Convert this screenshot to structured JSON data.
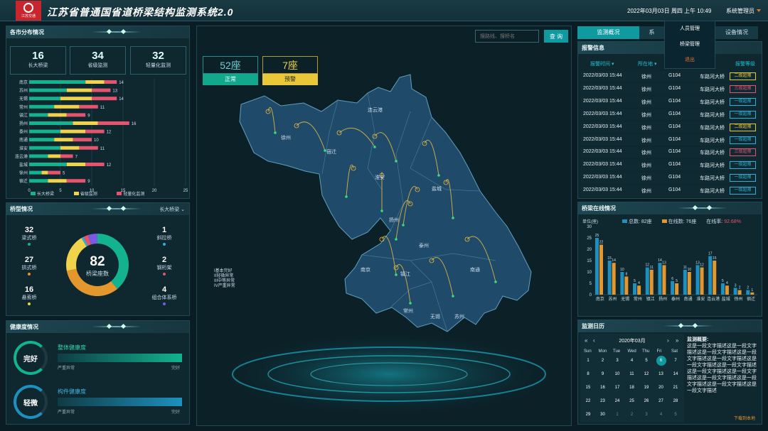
{
  "header": {
    "logo_text": "江苏交通",
    "title": "江苏省普通国省道桥梁结构监测系统2.0",
    "datetime": "2022年03月03日 周四 上午 10:49",
    "user": "系统管理员"
  },
  "dropdown": [
    "人员管理",
    "桥梁管理",
    "退出"
  ],
  "dist": {
    "title": "各市分布情况",
    "stats": [
      {
        "n": "16",
        "l": "长大桥梁"
      },
      {
        "n": "34",
        "l": "省级监测"
      },
      {
        "n": "32",
        "l": "轻量化监测"
      }
    ],
    "legend": [
      "长大桥梁",
      "省级监测",
      "轻量化监测"
    ],
    "colors": [
      "#12b38e",
      "#f0d34b",
      "#e4546e"
    ]
  },
  "chart_data": [
    {
      "type": "bar",
      "orientation": "horizontal",
      "stacked": true,
      "categories": [
        "南京",
        "苏州",
        "无锡",
        "常州",
        "镇江",
        "扬州",
        "泰州",
        "南通",
        "淮安",
        "连云港",
        "盐城",
        "徐州",
        "宿迁"
      ],
      "totals": [
        14,
        13,
        14,
        11,
        9,
        16,
        12,
        10,
        11,
        7,
        12,
        5,
        9
      ],
      "series": [
        {
          "name": "长大桥梁",
          "values": [
            9,
            6,
            5,
            4,
            3,
            7,
            5,
            4,
            5,
            3,
            6,
            2,
            3
          ]
        },
        {
          "name": "省级监测",
          "values": [
            3,
            4,
            5,
            4,
            3,
            4,
            4,
            3,
            3,
            2,
            3,
            1,
            3
          ]
        },
        {
          "name": "轻量化监测",
          "values": [
            2,
            3,
            4,
            3,
            3,
            5,
            3,
            3,
            3,
            2,
            3,
            2,
            3
          ]
        }
      ],
      "xlim": [
        0,
        25
      ],
      "xticks": [
        "0",
        "5",
        "10",
        "15",
        "20",
        "25"
      ]
    },
    {
      "type": "pie",
      "title": "桥梁座数",
      "total": "82",
      "slices": [
        {
          "name": "梁式桥",
          "value": 32,
          "color": "#12b38e"
        },
        {
          "name": "拱式桥",
          "value": 27,
          "color": "#e3972c"
        },
        {
          "name": "悬索桥",
          "value": 16,
          "color": "#f0d34b"
        },
        {
          "name": "斜拉桥",
          "value": 1,
          "color": "#2fb0d6"
        },
        {
          "name": "钢桁架",
          "value": 2,
          "color": "#e4546e"
        },
        {
          "name": "组合体系桥",
          "value": 4,
          "color": "#7a5ae0"
        }
      ]
    },
    {
      "type": "bar",
      "title": "桥梁在线情况",
      "ylabel": "单位(座)",
      "categories": [
        "南京",
        "苏州",
        "无锡",
        "常州",
        "镇江",
        "扬州",
        "泰州",
        "南通",
        "淮安",
        "连云港",
        "盐城",
        "徐州",
        "宿迁"
      ],
      "series": [
        {
          "name": "总数",
          "values": [
            25,
            15,
            10,
            5,
            12,
            14,
            6,
            11,
            13,
            17,
            5,
            3,
            2
          ]
        },
        {
          "name": "在线数",
          "values": [
            22,
            14,
            8,
            4,
            11,
            13,
            5,
            10,
            12,
            15,
            4,
            2,
            1
          ]
        }
      ],
      "ylim": [
        0,
        30
      ],
      "yticks": [
        "0",
        "5",
        "10",
        "15",
        "20",
        "25",
        "30"
      ]
    }
  ],
  "bridge_type": {
    "title": "桥型情况",
    "select": "长大桥梁",
    "left": [
      {
        "n": "32",
        "l": "梁式桥"
      },
      {
        "n": "27",
        "l": "拱式桥"
      },
      {
        "n": "16",
        "l": "悬索桥"
      }
    ],
    "right": [
      {
        "n": "1",
        "l": "斜拉桥"
      },
      {
        "n": "2",
        "l": "钢桁架"
      },
      {
        "n": "4",
        "l": "组合体系桥"
      }
    ]
  },
  "health": {
    "title": "健康度情况",
    "items": [
      {
        "badge": "完好",
        "label": "整体健康度",
        "low": "严重异常",
        "high": "完好"
      },
      {
        "badge": "轻微",
        "label": "构件健康度",
        "low": "严重异常",
        "high": "完好"
      }
    ]
  },
  "map": {
    "normal_count": "52座",
    "normal_label": "正常",
    "warn_count": "7座",
    "warn_label": "预警",
    "search_placeholder": "搜路线、搜桥名",
    "search_btn": "查 询",
    "legend": [
      "I基本完好",
      "II轻微异常",
      "III中等异常",
      "IV严重异常"
    ],
    "cities": [
      "连云港",
      "徐州",
      "宿迁",
      "淮安",
      "盐城",
      "扬州",
      "泰州",
      "南京",
      "镇江",
      "南通",
      "常州",
      "无锡",
      "苏州"
    ]
  },
  "tabs": [
    "监测概况",
    "系",
    "设备情况"
  ],
  "alarm": {
    "title": "报警信息",
    "headers": [
      "报警时间",
      "所在地",
      "",
      "报警等级"
    ],
    "rows": [
      {
        "t": "2022/03/03 15:44",
        "c": "徐州",
        "r": "G104",
        "b": "车路河大桥",
        "lv": "二级超限",
        "col": "#e8c838"
      },
      {
        "t": "2022/03/03 15:44",
        "c": "徐州",
        "r": "G104",
        "b": "车路河大桥",
        "lv": "三级超限",
        "col": "#e4546e"
      },
      {
        "t": "2022/03/03 15:44",
        "c": "徐州",
        "r": "G104",
        "b": "车路河大桥",
        "lv": "一级超限",
        "col": "#2fb0d6"
      },
      {
        "t": "2022/03/03 15:44",
        "c": "徐州",
        "r": "G104",
        "b": "车路河大桥",
        "lv": "一级超限",
        "col": "#2fb0d6"
      },
      {
        "t": "2022/03/03 15:44",
        "c": "徐州",
        "r": "G104",
        "b": "车路河大桥",
        "lv": "二级超限",
        "col": "#e8c838"
      },
      {
        "t": "2022/03/03 15:44",
        "c": "徐州",
        "r": "G104",
        "b": "车路河大桥",
        "lv": "一级超限",
        "col": "#2fb0d6"
      },
      {
        "t": "2022/03/03 15:44",
        "c": "徐州",
        "r": "G104",
        "b": "车路河大桥",
        "lv": "三级超限",
        "col": "#e4546e"
      },
      {
        "t": "2022/03/03 15:44",
        "c": "徐州",
        "r": "G104",
        "b": "车路河大桥",
        "lv": "一级超限",
        "col": "#2fb0d6"
      },
      {
        "t": "2022/03/03 15:44",
        "c": "徐州",
        "r": "G104",
        "b": "车路河大桥",
        "lv": "一级超限",
        "col": "#2fb0d6"
      },
      {
        "t": "2022/03/03 15:44",
        "c": "徐州",
        "r": "G104",
        "b": "车路河大桥",
        "lv": "一级超限",
        "col": "#2fb0d6"
      }
    ]
  },
  "online": {
    "title": "桥梁在线情况",
    "total": "总数: 82座",
    "online": "在线数: 76座",
    "rate_label": "在线率:",
    "rate": "92.68%"
  },
  "calendar": {
    "title": "监测日历",
    "month": "2020年03月",
    "weekdays": [
      "Sun",
      "Mon",
      "Tue",
      "Wed",
      "Thu",
      "Fri",
      "Sat"
    ],
    "days": [
      "1",
      "2",
      "3",
      "4",
      "5",
      "6",
      "7",
      "8",
      "9",
      "10",
      "11",
      "12",
      "13",
      "14",
      "15",
      "16",
      "17",
      "18",
      "19",
      "20",
      "21",
      "22",
      "23",
      "24",
      "25",
      "26",
      "27",
      "28",
      "29",
      "30",
      "1",
      "2",
      "3",
      "4",
      "5"
    ],
    "summary_title": "监测概要:",
    "summary": "这是一段文字描述这是一段文字描述这是一段文字描述这是一段文字描述这是一段文字描述这是一段文字描述这是一段文字描述这是一段文字描述这是一段文字描述这是一段文字描述这是一段文字描述这是一段文字描述这是一段文字描述",
    "download": "下载到本地"
  }
}
